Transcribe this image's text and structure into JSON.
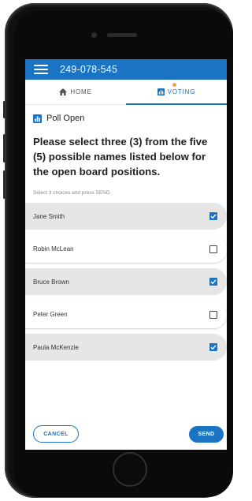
{
  "appbar": {
    "title": "249-078-545",
    "menu_icon": "hamburger-menu-icon"
  },
  "tabs": [
    {
      "label": "HOME",
      "icon": "home-icon",
      "active": false
    },
    {
      "label": "VOTING",
      "icon": "bar-chart-icon",
      "active": true
    }
  ],
  "poll": {
    "status": "Poll Open",
    "status_icon": "bar-chart-icon",
    "question": "Please select three (3) from the five (5) possible names listed below for the open board positions.",
    "instructions": "Select 3 choices and press SEND.",
    "options": [
      {
        "name": "Jane Smith",
        "checked": true
      },
      {
        "name": "Robin McLean",
        "checked": false
      },
      {
        "name": "Bruce Brown",
        "checked": true
      },
      {
        "name": "Peter Green",
        "checked": false
      },
      {
        "name": "Paula McKenzie",
        "checked": true
      }
    ]
  },
  "actions": {
    "cancel_label": "CANCEL",
    "send_label": "SEND"
  },
  "colors": {
    "primary": "#1b73c4",
    "badge": "#f4a33a",
    "selected_row": "#e6e6e6"
  }
}
